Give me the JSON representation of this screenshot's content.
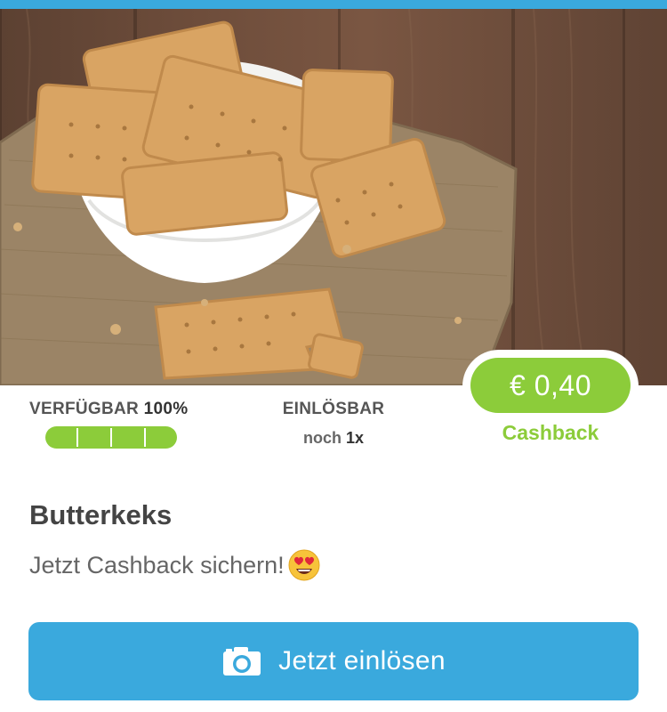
{
  "offer": {
    "product_name": "Butterkeks",
    "tagline": "Jetzt Cashback sichern!",
    "tagline_emoji": "heart-eyes-emoji",
    "image_subject": "butter-biscuits-image"
  },
  "cashback": {
    "amount": "€ 0,40",
    "label": "Cashback"
  },
  "availability": {
    "label": "VERFÜGBAR",
    "value": "100%",
    "progress_fraction": 1.0,
    "segments": 5
  },
  "redeemable": {
    "label": "EINLÖSBAR",
    "prefix": "noch",
    "count": "1x"
  },
  "action": {
    "label": "Jetzt einlösen",
    "icon": "camera-icon"
  },
  "colors": {
    "accent_blue": "#3aa9dd",
    "accent_green": "#8ccc3a"
  }
}
